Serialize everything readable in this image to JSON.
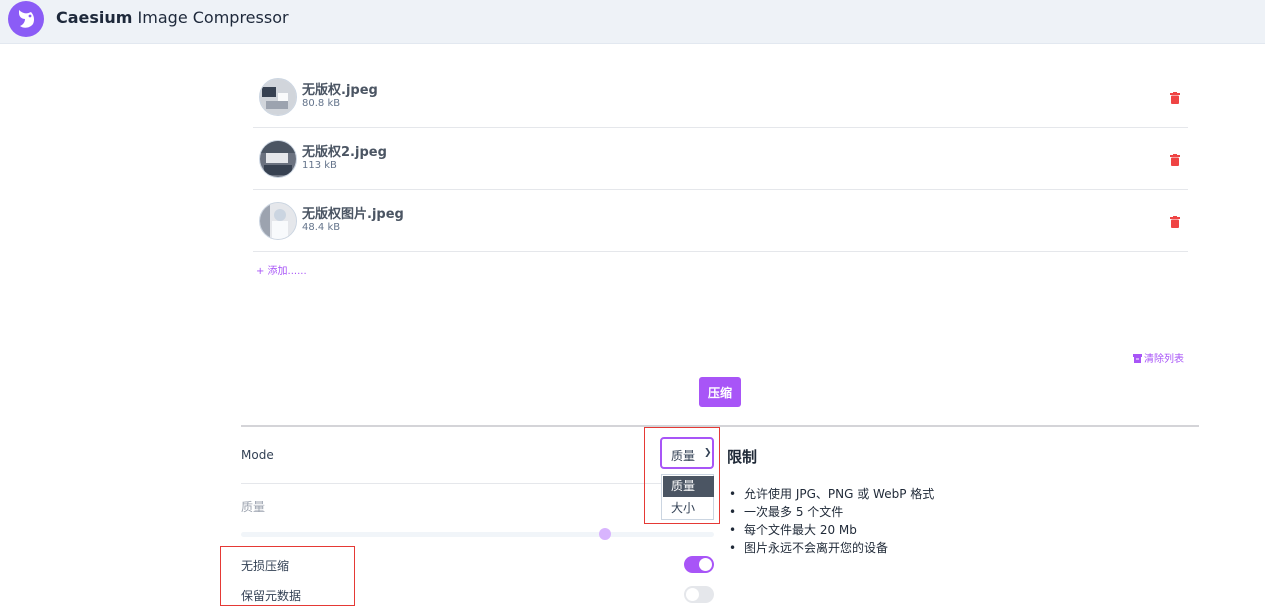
{
  "header": {
    "title_bold": "Caesium",
    "title_rest": " Image Compressor"
  },
  "files": [
    {
      "name": "无版权.jpeg",
      "size": "80.8 kB"
    },
    {
      "name": "无版权2.jpeg",
      "size": "113 kB"
    },
    {
      "name": "无版权图片.jpeg",
      "size": "48.4 kB"
    }
  ],
  "actions": {
    "add": "+ 添加......",
    "clear": "清除列表",
    "compress": "压缩"
  },
  "options": {
    "mode_label": "Mode",
    "mode_value": "质量",
    "mode_options": [
      "质量",
      "大小"
    ],
    "quality_label": "质量",
    "quality_level": 0.77,
    "lossless_label": "无损压缩",
    "lossless_on": true,
    "metadata_label": "保留元数据",
    "metadata_on": false
  },
  "limits": {
    "title": "限制",
    "items": [
      "允许使用 JPG、PNG 或 WebP 格式",
      "一次最多 5 个文件",
      "每个文件最大 20 Mb",
      "图片永远不会离开您的设备"
    ]
  },
  "colors": {
    "accent": "#a855f7",
    "danger": "#ef4444",
    "highlight": "#e53935"
  }
}
